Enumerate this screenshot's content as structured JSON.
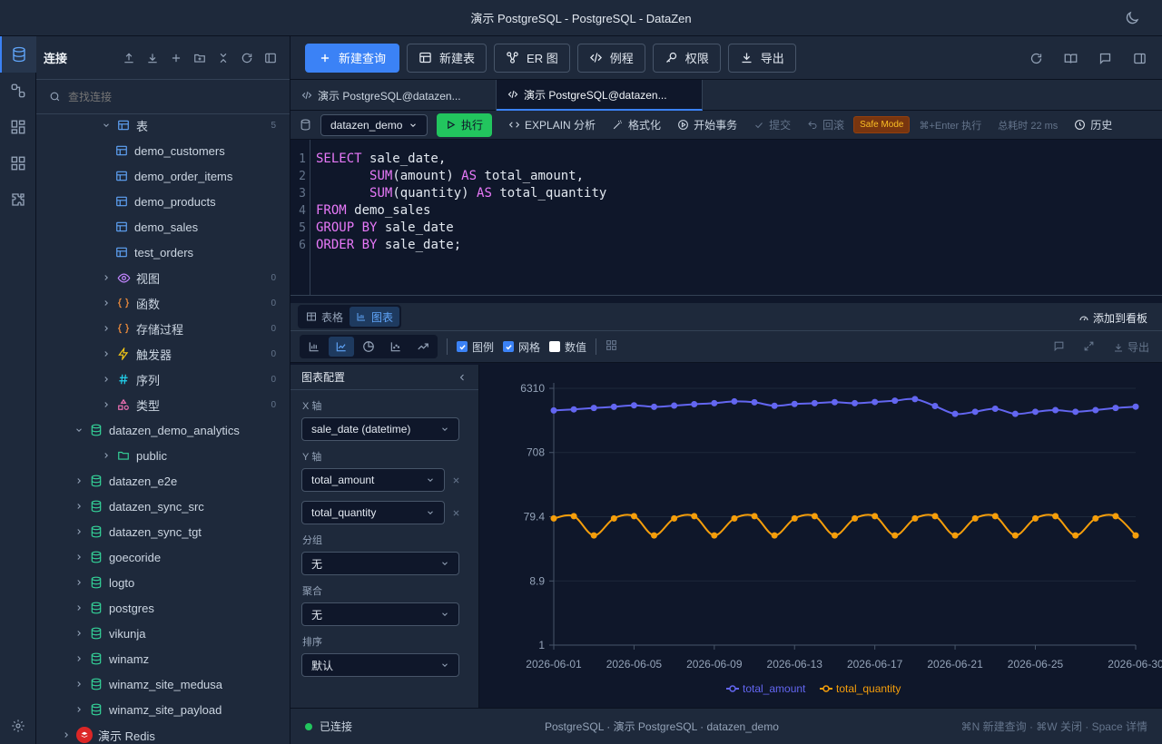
{
  "window": {
    "title": "演示 PostgreSQL - PostgreSQL - DataZen"
  },
  "sidebar": {
    "title": "连接",
    "search_placeholder": "查找连接",
    "tree": [
      {
        "label": "表",
        "level": 2,
        "chevron": "down",
        "icon": "table-icon",
        "count": "5"
      },
      {
        "label": "demo_customers",
        "level": 3,
        "icon": "table-icon"
      },
      {
        "label": "demo_order_items",
        "level": 3,
        "icon": "table-icon"
      },
      {
        "label": "demo_products",
        "level": 3,
        "icon": "table-icon"
      },
      {
        "label": "demo_sales",
        "level": 3,
        "icon": "table-icon"
      },
      {
        "label": "test_orders",
        "level": 3,
        "icon": "table-icon"
      },
      {
        "label": "视图",
        "level": 2,
        "chevron": "right",
        "icon": "eye-icon",
        "count": "0"
      },
      {
        "label": "函数",
        "level": 2,
        "chevron": "right",
        "icon": "braces-icon",
        "count": "0"
      },
      {
        "label": "存储过程",
        "level": 2,
        "chevron": "right",
        "icon": "braces-icon",
        "count": "0"
      },
      {
        "label": "触发器",
        "level": 2,
        "chevron": "right",
        "icon": "lightning-icon",
        "count": "0"
      },
      {
        "label": "序列",
        "level": 2,
        "chevron": "right",
        "icon": "hash-icon",
        "count": "0"
      },
      {
        "label": "类型",
        "level": 2,
        "chevron": "right",
        "icon": "shapes-icon",
        "count": "0"
      },
      {
        "label": "datazen_demo_analytics",
        "level": 1,
        "chevron": "down",
        "icon": "database-icon"
      },
      {
        "label": "public",
        "level": 2,
        "chevron": "right",
        "icon": "folder-icon"
      },
      {
        "label": "datazen_e2e",
        "level": 1,
        "chevron": "right",
        "icon": "database-icon"
      },
      {
        "label": "datazen_sync_src",
        "level": 1,
        "chevron": "right",
        "icon": "database-icon"
      },
      {
        "label": "datazen_sync_tgt",
        "level": 1,
        "chevron": "right",
        "icon": "database-icon"
      },
      {
        "label": "goecoride",
        "level": 1,
        "chevron": "right",
        "icon": "database-icon"
      },
      {
        "label": "logto",
        "level": 1,
        "chevron": "right",
        "icon": "database-icon"
      },
      {
        "label": "postgres",
        "level": 1,
        "chevron": "right",
        "icon": "database-icon"
      },
      {
        "label": "vikunja",
        "level": 1,
        "chevron": "right",
        "icon": "database-icon"
      },
      {
        "label": "winamz",
        "level": 1,
        "chevron": "right",
        "icon": "database-icon"
      },
      {
        "label": "winamz_site_medusa",
        "level": 1,
        "chevron": "right",
        "icon": "database-icon"
      },
      {
        "label": "winamz_site_payload",
        "level": 1,
        "chevron": "right",
        "icon": "database-icon"
      },
      {
        "label": "演示 Redis",
        "level": 0,
        "chevron": "right",
        "icon": "redis-icon"
      }
    ]
  },
  "toolbar": {
    "new_query": "新建查询",
    "new_table": "新建表",
    "er": "ER 图",
    "routines": "例程",
    "perms": "权限",
    "export": "导出"
  },
  "tabs": [
    {
      "label": "演示 PostgreSQL@datazen..."
    },
    {
      "label": "演示 PostgreSQL@datazen..."
    }
  ],
  "querybar": {
    "db": "datazen_demo",
    "run": "执行",
    "explain": "EXPLAIN 分析",
    "format": "格式化",
    "begin": "开始事务",
    "commit": "提交",
    "rollback": "回滚",
    "safe_mode": "Safe Mode",
    "shortcut": "⌘+Enter 执行",
    "elapsed": "总耗时 22 ms",
    "history": "历史"
  },
  "editor": {
    "line_numbers": [
      "1",
      "2",
      "3",
      "4",
      "5",
      "6"
    ],
    "lines": [
      [
        {
          "k": "SELECT"
        },
        {
          "t": " sale_date,"
        }
      ],
      [
        {
          "t": "       "
        },
        {
          "k": "SUM"
        },
        {
          "t": "(amount) "
        },
        {
          "k": "AS"
        },
        {
          "t": " total_amount,"
        }
      ],
      [
        {
          "t": "       "
        },
        {
          "k": "SUM"
        },
        {
          "t": "(quantity) "
        },
        {
          "k": "AS"
        },
        {
          "t": " total_quantity"
        }
      ],
      [
        {
          "k": "FROM"
        },
        {
          "t": " demo_sales"
        }
      ],
      [
        {
          "k": "GROUP BY"
        },
        {
          "t": " sale_date"
        }
      ],
      [
        {
          "k": "ORDER BY"
        },
        {
          "t": " sale_date;"
        }
      ]
    ]
  },
  "results": {
    "table_tab": "表格",
    "chart_tab": "图表",
    "add_dashboard": "添加到看板",
    "legend_label": "图例",
    "grid_label": "网格",
    "values_label": "数值",
    "export": "导出"
  },
  "config": {
    "title": "图表配置",
    "x_label": "X 轴",
    "x_value": "sale_date (datetime)",
    "y_label": "Y 轴",
    "y_values": [
      "total_amount",
      "total_quantity"
    ],
    "group_label": "分组",
    "group_value": "无",
    "agg_label": "聚合",
    "agg_value": "无",
    "sort_label": "排序",
    "sort_value": "默认"
  },
  "chart_data": {
    "type": "line",
    "y_scale": "log",
    "ylim": [
      1,
      6310
    ],
    "yticks": [
      "1",
      "8.9",
      "79.4",
      "708",
      "6310"
    ],
    "ytick_values": [
      1,
      8.9,
      79.4,
      708,
      6310
    ],
    "x": [
      "2026-06-01",
      "2026-06-02",
      "2026-06-03",
      "2026-06-04",
      "2026-06-05",
      "2026-06-06",
      "2026-06-07",
      "2026-06-08",
      "2026-06-09",
      "2026-06-10",
      "2026-06-11",
      "2026-06-12",
      "2026-06-13",
      "2026-06-14",
      "2026-06-15",
      "2026-06-16",
      "2026-06-17",
      "2026-06-18",
      "2026-06-19",
      "2026-06-20",
      "2026-06-21",
      "2026-06-22",
      "2026-06-23",
      "2026-06-24",
      "2026-06-25",
      "2026-06-26",
      "2026-06-27",
      "2026-06-28",
      "2026-06-29",
      "2026-06-30"
    ],
    "xticks": [
      "2026-06-01",
      "2026-06-05",
      "2026-06-09",
      "2026-06-13",
      "2026-06-17",
      "2026-06-21",
      "2026-06-25",
      "2026-06-30"
    ],
    "grid": true,
    "legend": "bottom",
    "series": [
      {
        "name": "total_amount",
        "color": "#6366f1",
        "values": [
          2970,
          3080,
          3230,
          3360,
          3540,
          3360,
          3500,
          3670,
          3800,
          4040,
          3920,
          3480,
          3700,
          3800,
          3940,
          3800,
          3960,
          4140,
          4370,
          3450,
          2640,
          2840,
          3150,
          2640,
          2840,
          3000,
          2840,
          3000,
          3230,
          3380
        ]
      },
      {
        "name": "total_quantity",
        "color": "#f59e0b",
        "values": [
          75,
          81,
          42,
          75,
          81,
          42,
          75,
          81,
          42,
          75,
          81,
          42,
          75,
          81,
          42,
          75,
          81,
          42,
          75,
          81,
          42,
          75,
          81,
          42,
          75,
          81,
          42,
          75,
          81,
          42
        ]
      }
    ]
  },
  "status": {
    "connected": "已连接",
    "info": "PostgreSQL · 演示 PostgreSQL · datazen_demo",
    "shortcuts": "⌘N 新建查询 · ⌘W 关闭 · Space 详情"
  }
}
